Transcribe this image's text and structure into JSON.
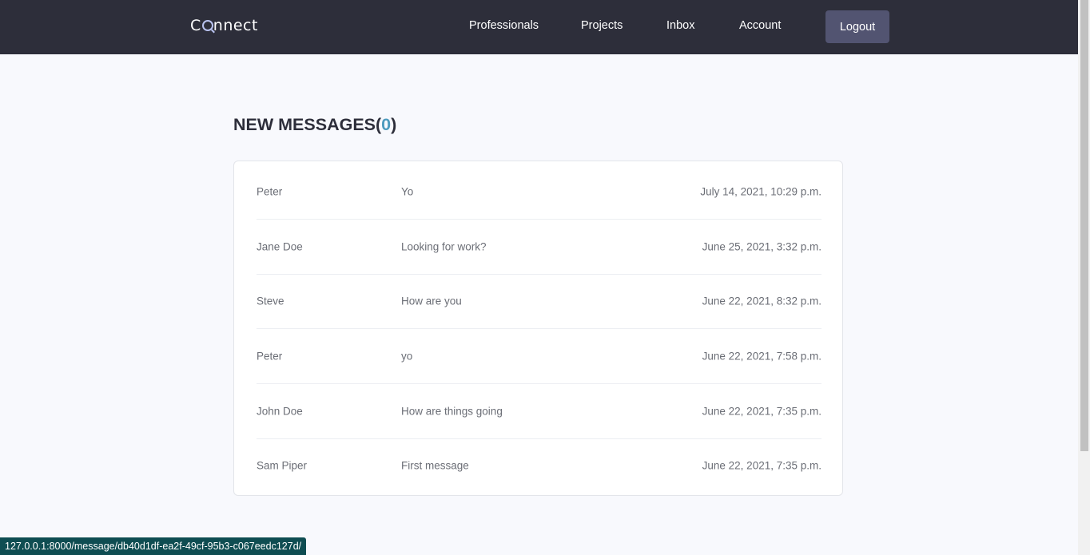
{
  "navbar": {
    "logo_prefix": "C",
    "logo_suffix": "nnect",
    "links": [
      "Professionals",
      "Projects",
      "Inbox",
      "Account"
    ],
    "logout_label": "Logout"
  },
  "inbox": {
    "heading_label": "NEW MESSAGES",
    "open_paren": "(",
    "new_count": "0",
    "close_paren": ")",
    "messages": [
      {
        "sender": "Peter",
        "subject": "Yo",
        "date": "July 14, 2021, 10:29 p.m."
      },
      {
        "sender": "Jane Doe",
        "subject": "Looking for work?",
        "date": "June 25, 2021, 3:32 p.m."
      },
      {
        "sender": "Steve",
        "subject": "How are you",
        "date": "June 22, 2021, 8:32 p.m."
      },
      {
        "sender": "Peter",
        "subject": "yo",
        "date": "June 22, 2021, 7:58 p.m."
      },
      {
        "sender": "John Doe",
        "subject": "How are things going",
        "date": "June 22, 2021, 7:35 p.m."
      },
      {
        "sender": "Sam Piper",
        "subject": "First message",
        "date": "June 22, 2021, 7:35 p.m."
      }
    ]
  },
  "status_bar": {
    "url": "127.0.0.1:8000/message/db40d1df-ea2f-49cf-95b3-c067eedc127d/"
  },
  "colors": {
    "navbar_bg": "#2d2e3a",
    "logout_bg": "#525471",
    "accent_count": "#4d9bbe",
    "page_bg": "#f8f9fd"
  }
}
